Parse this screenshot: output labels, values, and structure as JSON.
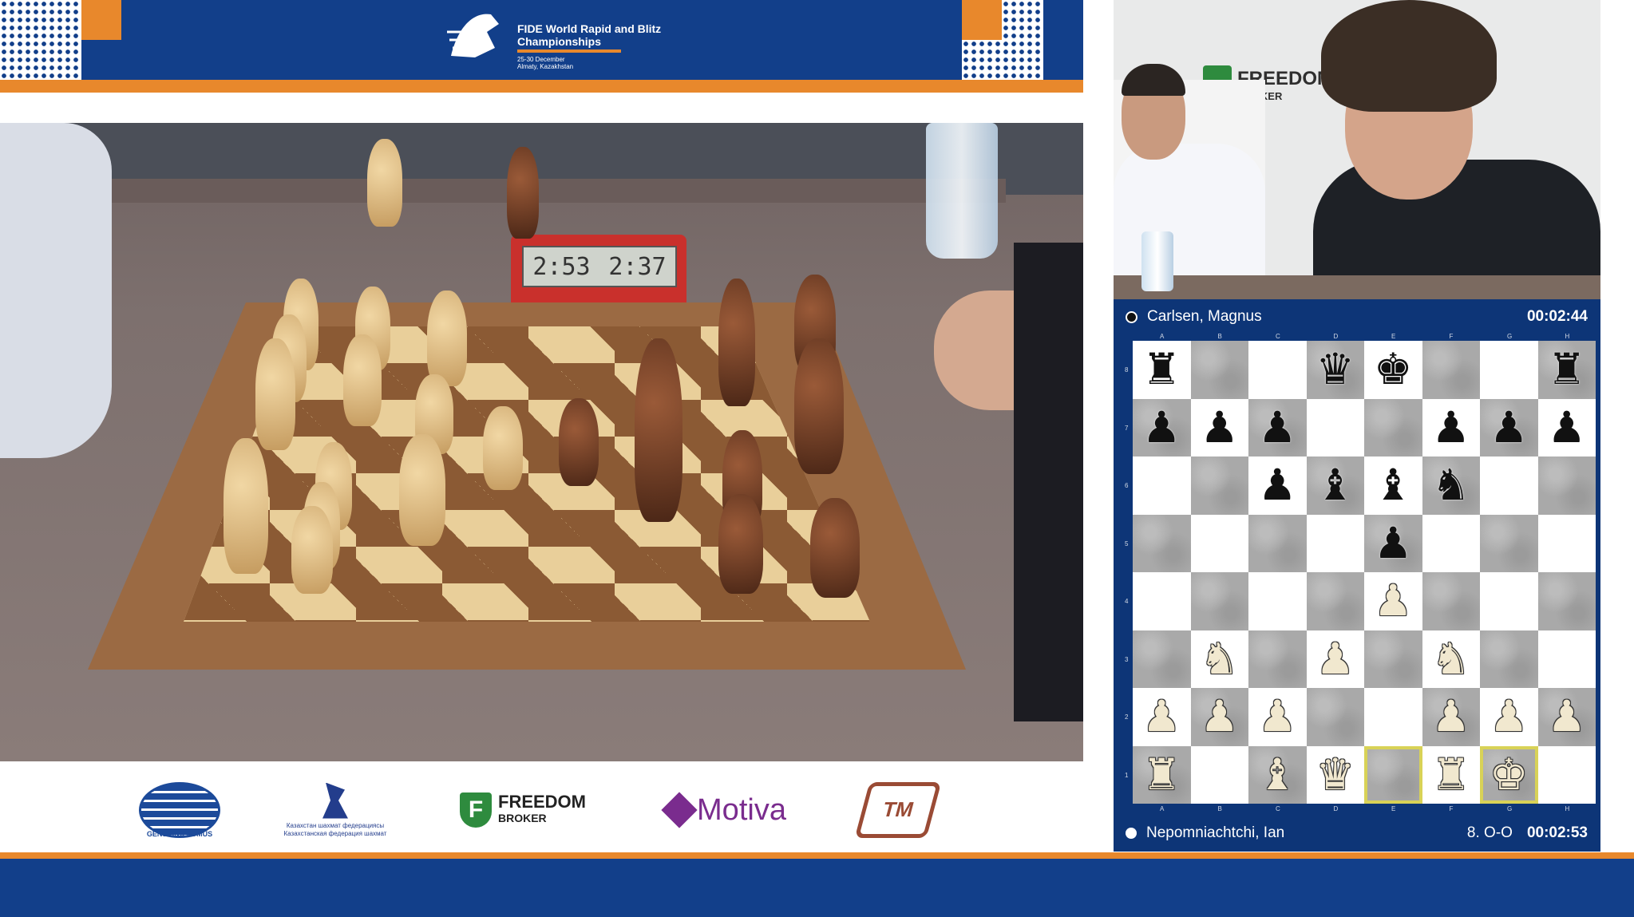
{
  "event": {
    "title": "FIDE World Rapid and Blitz Championships",
    "dates": "25-30 December",
    "city": "Almaty, Kazakhstan"
  },
  "camera_clock": {
    "left_time": "2:53",
    "right_time": "2:37"
  },
  "sponsors": {
    "fide_motto": "GENS UNA SUMUS",
    "fide_label": "FIDE",
    "kz_text": "Казахстан шахмат федерациясы Казахстанская федерация шахмат",
    "freedom_name": "FREEDOM",
    "freedom_sub": "BROKER",
    "motiva": "Motiva",
    "tm_badge": "TM"
  },
  "webcam": {
    "logo_name": "FREEDOM",
    "logo_sub": "BROKER"
  },
  "panel": {
    "black_player": {
      "name": "Carlsen, Magnus",
      "clock": "00:02:44",
      "color": "black"
    },
    "white_player": {
      "name": "Nepomniachtchi, Ian",
      "clock": "00:02:53",
      "last_move": "8. O-O",
      "color": "white"
    },
    "files": [
      "A",
      "B",
      "C",
      "D",
      "E",
      "F",
      "G",
      "H"
    ],
    "ranks": [
      "8",
      "7",
      "6",
      "5",
      "4",
      "3",
      "2",
      "1"
    ],
    "position": [
      [
        "br",
        "",
        "",
        "bq",
        "bk",
        "",
        "",
        "br"
      ],
      [
        "bp",
        "bp",
        "bp",
        "",
        "",
        "bp",
        "bp",
        "bp"
      ],
      [
        "",
        "",
        "bp",
        "bb",
        "bb",
        "bn",
        "",
        ""
      ],
      [
        "",
        "",
        "",
        "",
        "bp",
        "",
        "",
        ""
      ],
      [
        "",
        "",
        "",
        "",
        "wp",
        "",
        "",
        ""
      ],
      [
        "",
        "wn",
        "",
        "wp",
        "",
        "wn",
        "",
        ""
      ],
      [
        "wp",
        "wp",
        "wp",
        "",
        "",
        "wp",
        "wp",
        "wp"
      ],
      [
        "wr",
        "",
        "wb",
        "wq",
        "",
        "wr",
        "wk",
        ""
      ]
    ],
    "highlight_squares": [
      "e1",
      "g1"
    ],
    "colors": {
      "panel_bg": "#0d3577",
      "highlight": "#d8d257",
      "banner": "#123f8a",
      "accent": "#e8882c"
    }
  }
}
